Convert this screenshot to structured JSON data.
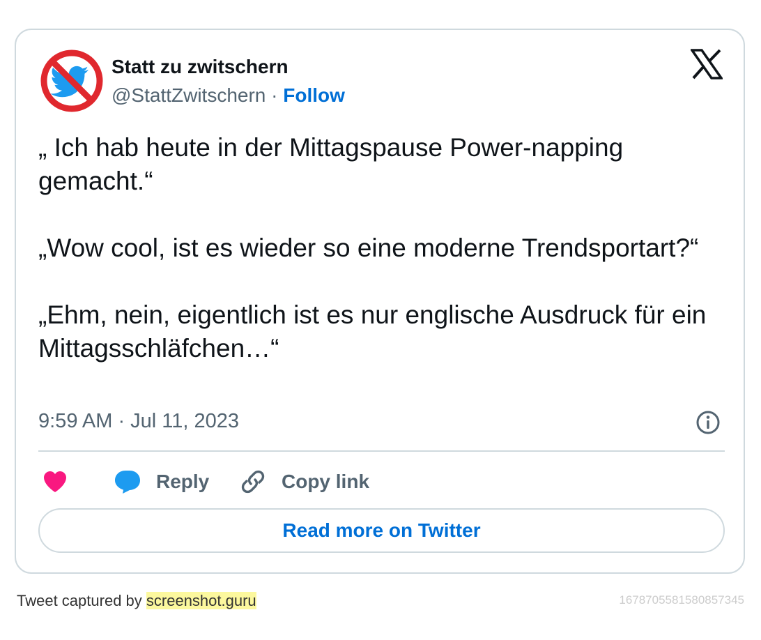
{
  "tweet": {
    "author": {
      "display_name": "Statt zu zwitschern",
      "handle": "@StattZwitschern",
      "separator": "·",
      "follow_label": "Follow"
    },
    "text": "„ Ich hab heute in der Mittagspause Power-napping gemacht.“\n\n„Wow cool, ist es wieder so eine moderne Trendsportart?“\n\n„Ehm, nein, eigentlich ist es nur englische Ausdruck für ein Mittagsschläfchen…“",
    "timestamp": "9:59 AM · Jul 11, 2023",
    "actions": {
      "reply_label": "Reply",
      "copy_link_label": "Copy link"
    },
    "read_more_label": "Read more on Twitter"
  },
  "footer": {
    "captured_by_prefix": "Tweet captured by ",
    "captured_by_link": "screenshot.guru",
    "tweet_id": "1678705581580857345"
  },
  "icons": {
    "avatar": "no-twitter-bird-avatar",
    "platform_logo": "x-logo-icon",
    "info": "info-icon",
    "like": "heart-icon",
    "reply": "speech-bubble-icon",
    "copy_link": "link-icon"
  },
  "colors": {
    "link_blue": "#006fd6",
    "like_pink": "#f91880",
    "reply_blue": "#1d9bf0",
    "muted_text": "#536471",
    "border": "#cfd9de",
    "footer_highlight": "#fcf89e"
  }
}
